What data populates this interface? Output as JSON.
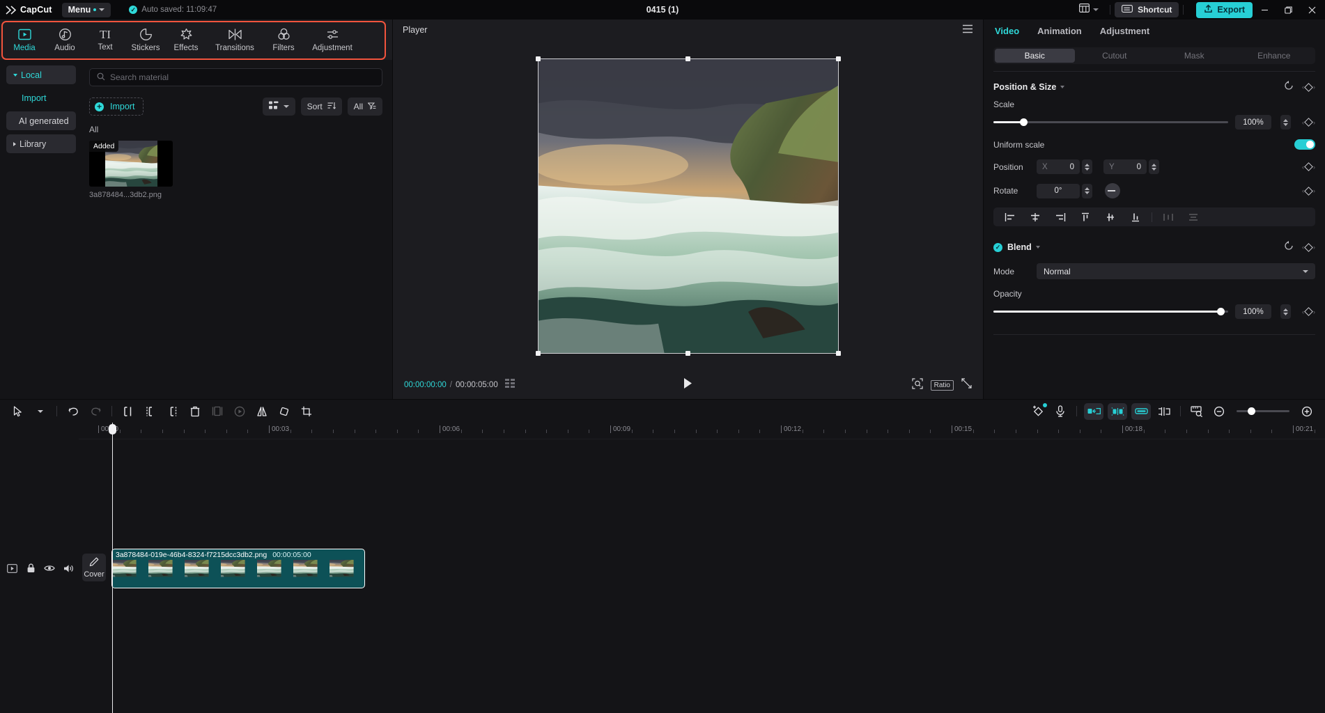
{
  "titlebar": {
    "app_name": "CapCut",
    "menu_label": "Menu",
    "autosave_text": "Auto saved: 11:09:47",
    "project_title": "0415 (1)",
    "shortcut_label": "Shortcut",
    "export_label": "Export",
    "layout_icon": "layout-grid-icon",
    "minimize_icon": "minimize-icon",
    "maximize_icon": "maximize-icon",
    "close_icon": "close-icon"
  },
  "nav": {
    "items": [
      {
        "label": "Media",
        "icon": "media-play-box-icon",
        "active": true
      },
      {
        "label": "Audio",
        "icon": "audio-note-icon",
        "active": false
      },
      {
        "label": "Text",
        "icon": "text-TI-icon",
        "active": false
      },
      {
        "label": "Stickers",
        "icon": "sticker-circle-icon",
        "active": false
      },
      {
        "label": "Effects",
        "icon": "effects-sparkle-icon",
        "active": false
      },
      {
        "label": "Transitions",
        "icon": "transitions-bowtie-icon",
        "active": false
      },
      {
        "label": "Filters",
        "icon": "filters-rings-icon",
        "active": false
      },
      {
        "label": "Adjustment",
        "icon": "adjustment-sliders-icon",
        "active": false
      }
    ],
    "highlight_color": "#f2543d"
  },
  "categories": [
    {
      "label": "Local",
      "state": "selected",
      "arrow": "down"
    },
    {
      "label": "Import",
      "state": "sub-selected",
      "arrow": "none"
    },
    {
      "label": "AI generated",
      "state": "plain",
      "arrow": "none"
    },
    {
      "label": "Library",
      "state": "library",
      "arrow": "right"
    }
  ],
  "media_panel": {
    "search_placeholder": "Search material",
    "search_icon": "search-icon",
    "import_label": "Import",
    "view_chip_icon": "grid-view-icon",
    "sort_label": "Sort",
    "sort_icon": "sort-icon",
    "filter_label": "All",
    "filter_icon": "filter-icon",
    "section_label": "All",
    "items": [
      {
        "name": "3a878484...3db2.png",
        "badge": "Added"
      }
    ]
  },
  "player": {
    "title": "Player",
    "menu_icon": "hamburger-icon",
    "current_time": "00:00:00:00",
    "separator": "/",
    "total_time": "00:00:05:00",
    "frames_icon": "frames-icon",
    "play_icon": "play-icon",
    "zoom_icon": "zoom-fit-icon",
    "ratio_label": "Ratio",
    "fullscreen_icon": "fullscreen-icon"
  },
  "inspector": {
    "tabs": [
      {
        "label": "Video",
        "active": true
      },
      {
        "label": "Animation",
        "active": false
      },
      {
        "label": "Adjustment",
        "active": false
      }
    ],
    "segments": [
      {
        "label": "Basic",
        "active": true
      },
      {
        "label": "Cutout",
        "active": false
      },
      {
        "label": "Mask",
        "active": false
      },
      {
        "label": "Enhance",
        "active": false
      }
    ],
    "position_size": {
      "title": "Position & Size",
      "reset_icon": "reset-icon",
      "keyframe_icon": "keyframe-diamond-icon",
      "scale_label": "Scale",
      "scale_value": "100%",
      "scale_percent_of_track": 13,
      "uniform_scale_label": "Uniform scale",
      "uniform_scale_on": true,
      "position_label": "Position",
      "position_x_axis": "X",
      "position_x_value": "0",
      "position_y_axis": "Y",
      "position_y_value": "0",
      "rotate_label": "Rotate",
      "rotate_value": "0°",
      "align_icons": [
        "align-left-icon",
        "align-center-h-icon",
        "align-right-icon",
        "align-top-icon",
        "align-center-v-icon",
        "align-bottom-icon",
        "distribute-h-icon",
        "distribute-v-icon"
      ]
    },
    "blend": {
      "title": "Blend",
      "enabled": true,
      "mode_label": "Mode",
      "mode_value": "Normal",
      "opacity_label": "Opacity",
      "opacity_value": "100%",
      "opacity_percent_of_track": 97
    }
  },
  "timeline": {
    "toolbar_left": [
      "select-cursor-icon",
      "dropdown-caret-icon",
      "undo-icon",
      "redo-icon",
      "split-left-icon",
      "split-icon",
      "split-right-icon",
      "delete-icon",
      "freeze-frame-icon",
      "preview-icon",
      "mirror-icon",
      "rotate-icon",
      "crop-icon"
    ],
    "toolbar_right": [
      "add-keyframe-icon",
      "record-mic-icon",
      "ripple-delete-icon",
      "auto-cut-icon",
      "link-clip-icon",
      "detach-audio-icon",
      "snap-magnet-icon",
      "zoom-out-icon",
      "zoom-slider",
      "zoom-in-icon",
      "fit-timeline-icon"
    ],
    "ruler_labels": [
      "00:00",
      "00:03",
      "00:06",
      "00:09",
      "00:12",
      "00:15",
      "00:18",
      "00:21"
    ],
    "track_controls": [
      "track-mode-icon",
      "lock-icon",
      "eye-icon",
      "volume-icon"
    ],
    "cover_label": "Cover",
    "cover_icon": "pencil-icon",
    "clip": {
      "name": "3a878484-019e-46b4-8324-f7215dcc3db2.png",
      "duration": "00:00:05:00",
      "color": "#0d5157",
      "frame_count": 7
    },
    "playhead_position": "00:00"
  }
}
